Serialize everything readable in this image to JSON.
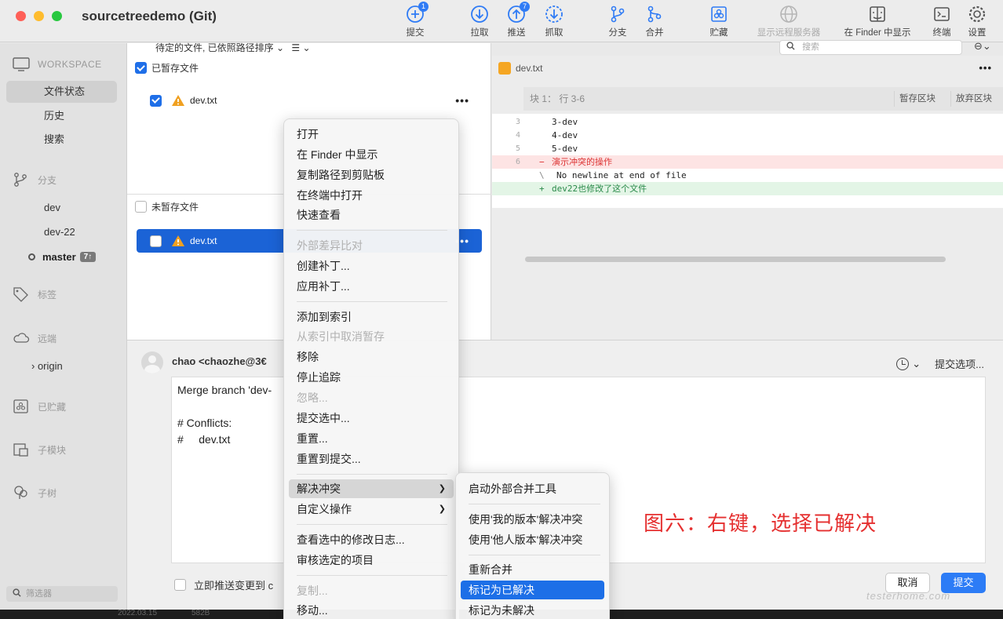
{
  "window": {
    "title": "sourcetreedemo (Git)"
  },
  "toolbar": {
    "commit": {
      "label": "提交",
      "badge": "1"
    },
    "pull": {
      "label": "拉取"
    },
    "push": {
      "label": "推送",
      "badge": "7"
    },
    "fetch": {
      "label": "抓取"
    },
    "branch": {
      "label": "分支"
    },
    "merge": {
      "label": "合并"
    },
    "stash": {
      "label": "贮藏"
    },
    "remote": {
      "label": "显示远程服务器"
    },
    "finder": {
      "label": "在 Finder 中显示"
    },
    "terminal": {
      "label": "终端"
    },
    "settings": {
      "label": "设置"
    }
  },
  "sidebar": {
    "workspace": "WORKSPACE",
    "ws_items": [
      "文件状态",
      "历史",
      "搜索"
    ],
    "branches_head": "分支",
    "branches": [
      "dev",
      "dev-22"
    ],
    "current_branch": "master",
    "current_branch_count": "7↑",
    "tags_head": "标签",
    "remotes_head": "远端",
    "remote_origin": "origin",
    "stashes_head": "已贮藏",
    "submodules_head": "子模块",
    "subtrees_head": "子树",
    "filter_placeholder": "筛选器"
  },
  "files": {
    "sort_label": "待定的文件, 已依照路径排序",
    "search_placeholder": "搜索",
    "staged_head": "已暂存文件",
    "staged_file": "dev.txt",
    "unstaged_head": "未暂存文件",
    "unstaged_file": "dev.txt"
  },
  "diff": {
    "filename": "dev.txt",
    "hunk_label": "块 1：  行 3-6",
    "stage_hunk": "暂存区块",
    "discard_hunk": "放弃区块",
    "lines": [
      {
        "num": "3",
        "text": "3-dev"
      },
      {
        "num": "4",
        "text": "4-dev"
      },
      {
        "num": "5",
        "text": "5-dev"
      },
      {
        "num": "6",
        "text": "演示冲突的操作",
        "marker": "−"
      },
      {
        "num": "",
        "text": "No newline at end of file",
        "marker": "\\"
      },
      {
        "num": "",
        "text": "dev22也修改了这个文件",
        "marker": "+"
      }
    ]
  },
  "commit": {
    "author": "chao <chaozhe@3€",
    "message": "Merge branch 'dev-\n\n# Conflicts:\n#     dev.txt",
    "options": "提交选项...",
    "push_label": "立即推送变更到 c",
    "cancel": "取消",
    "submit": "提交",
    "status_date": "2022.03.15",
    "status_size": "582B"
  },
  "annotation": "图六：右键，选择已解决",
  "watermark": "testerhome.com",
  "context_menu": {
    "items": [
      "打开",
      "在 Finder 中显示",
      "复制路径到剪贴板",
      "在终端中打开",
      "快速查看",
      "外部差异比对",
      "创建补丁...",
      "应用补丁...",
      "添加到索引",
      "从索引中取消暂存",
      "移除",
      "停止追踪",
      "忽略...",
      "提交选中...",
      "重置...",
      "重置到提交...",
      "解决冲突",
      "自定义操作",
      "查看选中的修改日志...",
      "审核选定的项目",
      "复制...",
      "移动..."
    ]
  },
  "submenu": {
    "items": [
      "启动外部合并工具",
      "使用'我的版本'解决冲突",
      "使用'他人版本'解决冲突",
      "重新合并",
      "标记为已解决",
      "标记为未解决"
    ]
  }
}
